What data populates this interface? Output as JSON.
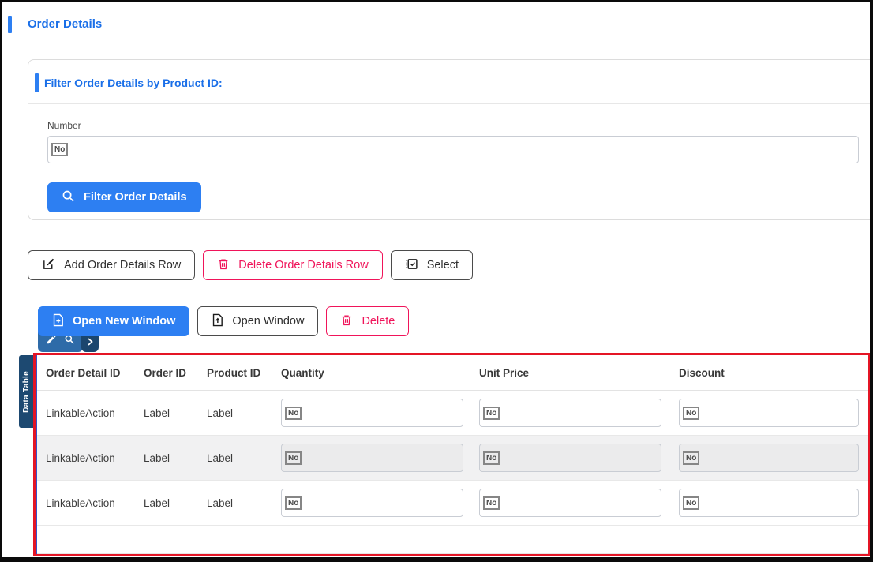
{
  "page": {
    "title": "Order Details"
  },
  "filter_panel": {
    "title": "Filter Order Details by Product ID:",
    "field_label": "Number",
    "field_chip": "No",
    "submit_label": "Filter Order Details"
  },
  "row_actions": {
    "add_label": "Add Order Details Row",
    "delete_label": "Delete Order Details Row",
    "select_label": "Select"
  },
  "window_actions": {
    "open_new_label": "Open New Window",
    "open_label": "Open Window",
    "delete_label": "Delete"
  },
  "mini_toolbar": {
    "icons": [
      "pencil-icon",
      "search-icon",
      "chevron-right-icon"
    ]
  },
  "data_table": {
    "side_label": "Data Table",
    "columns": [
      "Order Detail ID",
      "Order ID",
      "Product ID",
      "Quantity",
      "Unit Price",
      "Discount"
    ],
    "rows": [
      {
        "order_detail_id": "LinkableAction",
        "order_id": "Label",
        "product_id": "Label",
        "quantity": "No",
        "unit_price": "No",
        "discount": "No"
      },
      {
        "order_detail_id": "LinkableAction",
        "order_id": "Label",
        "product_id": "Label",
        "quantity": "No",
        "unit_price": "No",
        "discount": "No"
      },
      {
        "order_detail_id": "LinkableAction",
        "order_id": "Label",
        "product_id": "Label",
        "quantity": "No",
        "unit_price": "No",
        "discount": "No"
      }
    ]
  },
  "colors": {
    "primary_blue": "#2d7ff2",
    "title_blue": "#1a6fe8",
    "danger_pink": "#f0145a",
    "selection_border_red": "#e41525",
    "inner_selection_blue": "#3452c9",
    "mini_toolbar_steel_blue": "#2e6ba8",
    "mini_toolbar_navy": "#1b466e",
    "data_table_tag_navy": "#1d4971",
    "alt_row_gray": "#f1f1f2"
  }
}
